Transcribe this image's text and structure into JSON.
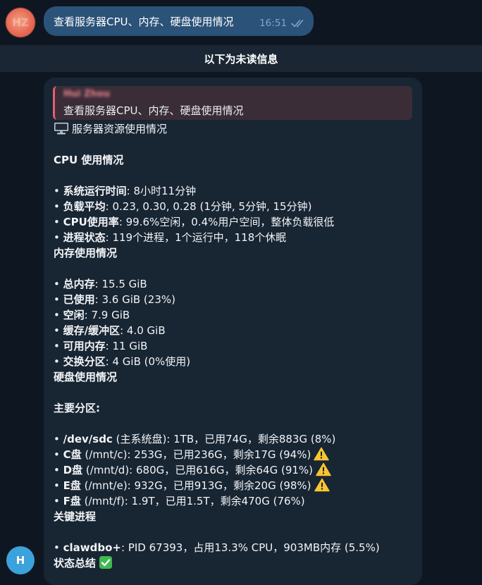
{
  "outgoing": {
    "avatar_initials": "HZ",
    "text": "查看服务器CPU、内存、硬盘使用情况",
    "time": "16:51"
  },
  "unread_label": "以下为未读信息",
  "incoming": {
    "avatar_initial": "H",
    "reply": {
      "name": "Hui Zhou",
      "text": "查看服务器CPU、内存、硬盘使用情况"
    },
    "title": "服务器资源使用情况",
    "cpu": {
      "heading": "CPU 使用情况",
      "items": [
        {
          "label": "系统运行时间",
          "value": ": 8小时11分钟"
        },
        {
          "label": "负载平均",
          "value": ": 0.23, 0.30, 0.28 (1分钟, 5分钟, 15分钟)"
        },
        {
          "label": "CPU使用率",
          "value": ": 99.6%空闲，0.4%用户空间，整体负载很低"
        },
        {
          "label": "进程状态",
          "value": ": 119个进程，1个运行中，118个休眠"
        }
      ]
    },
    "memory": {
      "heading": "内存使用情况",
      "items": [
        {
          "label": "总内存",
          "value": ": 15.5 GiB"
        },
        {
          "label": "已使用",
          "value": ": 3.6 GiB (23%)"
        },
        {
          "label": "空闲",
          "value": ": 7.9 GiB"
        },
        {
          "label": "缓存/缓冲区",
          "value": ": 4.0 GiB"
        },
        {
          "label": "可用内存",
          "value": ": 11 GiB"
        },
        {
          "label": "交换分区",
          "value": ": 4 GiB (0%使用)"
        }
      ]
    },
    "disk": {
      "heading": "硬盘使用情况",
      "subheading": "主要分区:",
      "items": [
        {
          "label": "/dev/sdc",
          "value": " (主系统盘): 1TB，已用74G，剩余883G (8%)"
        },
        {
          "label": "C盘",
          "value": " (/mnt/c): 253G，已用236G，剩余17G (94%)"
        },
        {
          "label": "D盘",
          "value": " (/mnt/d): 680G，已用616G，剩余64G (91%)"
        },
        {
          "label": "E盘",
          "value": " (/mnt/e): 932G，已用913G，剩余20G (98%)"
        },
        {
          "label": "F盘",
          "value": " (/mnt/f): 1.9T，已用1.5T，剩余470G (76%)"
        }
      ]
    },
    "process": {
      "heading": "关键进程",
      "items": [
        {
          "label": "clawdbo+",
          "value": ": PID 67393，占用13.3% CPU，903MB内存 (5.5%)"
        }
      ]
    },
    "summary_heading": "状态总结"
  },
  "colors": {
    "background": "#0e1621",
    "outgoing_bubble": "#2b5278",
    "incoming_bubble": "#182533",
    "reply_accent": "#e85d6e",
    "warning": "#f7c531",
    "check": "#3fb950"
  }
}
